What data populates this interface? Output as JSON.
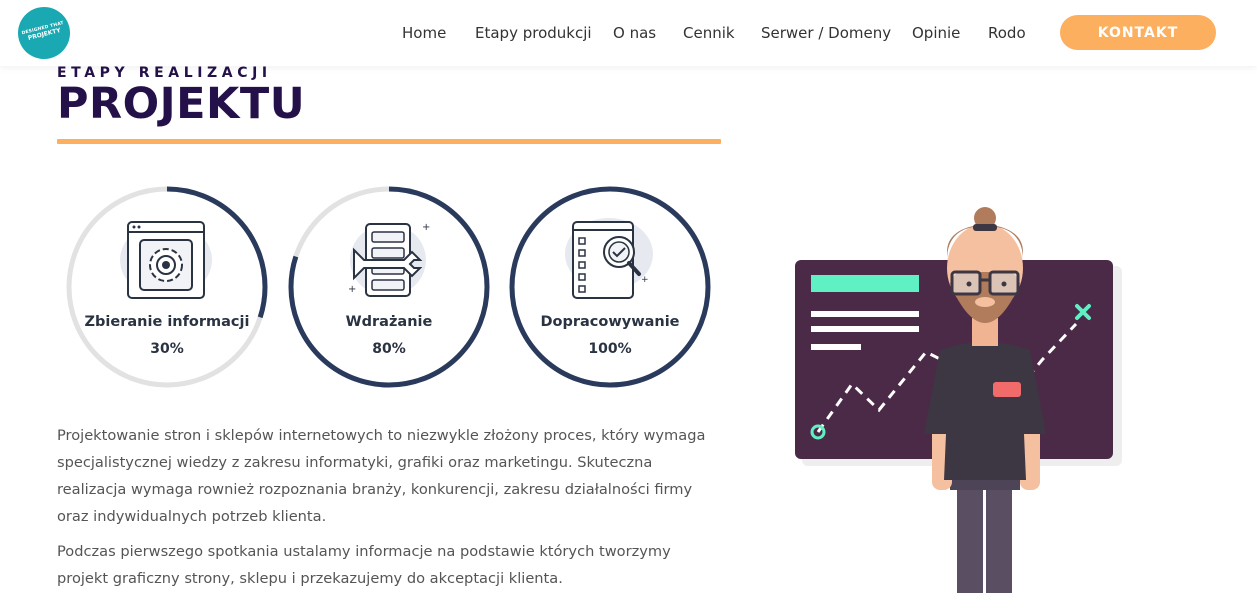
{
  "header": {
    "logo_text_line1": "DESIGNED THAT",
    "logo_text_line2": "PROJEKTY",
    "nav": [
      "Home",
      "Etapy produkcji",
      "O nas",
      "Cennik",
      "Serwer / Domeny",
      "Opinie",
      "Rodo"
    ],
    "cta_label": "KONTAKT",
    "colors": {
      "logo": "#1aa9b3",
      "cta": "#fcaf5e"
    }
  },
  "section": {
    "subtitle": "ETAPY REALIZACJI",
    "title": "PROJEKTU",
    "accent_color": "#fcaf5e",
    "title_color": "#24114a"
  },
  "progress": [
    {
      "label": "Zbieranie informacji",
      "value_text": "30%",
      "value": 0.3,
      "icon": "settings-window-icon"
    },
    {
      "label": "Wdrażanie",
      "value_text": "80%",
      "value": 0.8,
      "icon": "server-wrench-icon"
    },
    {
      "label": "Dopracowywanie",
      "value_text": "100%",
      "value": 1.0,
      "icon": "checklist-magnifier-icon"
    }
  ],
  "ring_colors": {
    "track": "#e2e2e2",
    "fill": "#2a3a5c"
  },
  "paragraphs": [
    "Projektowanie stron i sklepów internetowych to niezwykle złożony proces, który wymaga specjalistycznej wiedzy z zakresu informatyki, grafiki oraz marketingu. Skuteczna realizacja wymaga rownież rozpoznania branży, konkurencji, zakresu działalności firmy oraz indywidualnych potrzeb klienta.",
    "Podczas pierwszego spotkania ustalamy informacje na podstawie których tworzymy projekt graficzny strony, sklepu i przekazujemy do akceptacji klienta."
  ]
}
